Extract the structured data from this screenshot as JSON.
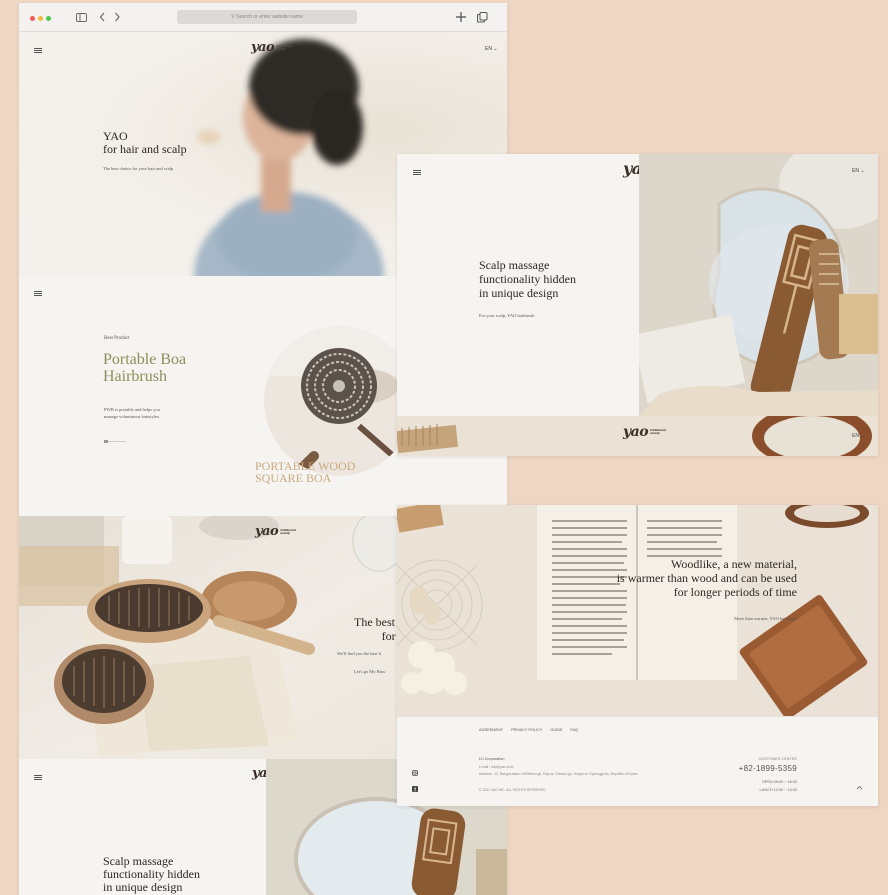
{
  "browser": {
    "address_placeholder": "Search or enter website name",
    "icons": [
      "sidebar-icon",
      "back-icon",
      "forward-icon",
      "new-tab-icon",
      "tabs-icon"
    ]
  },
  "brand": {
    "logo": "yao",
    "logo_sub": "for Wellness hair and scalp",
    "lang": "EN"
  },
  "hero": {
    "title_line1": "YAO",
    "title_line2": "for hair and scalp",
    "subtitle": "The best choice for your hair and scalp"
  },
  "product": {
    "eyebrow": "Best Product",
    "title_line1": "Portable Boa",
    "title_line2": "Hairbrush",
    "desc_line1": "PWB is portable and helps you",
    "desc_line2": "manage voluminous hairstyles.",
    "overlay_line1": "PORTABLE WOOD",
    "overlay_line2": "SQUARE BOA"
  },
  "choice": {
    "title_line1": "The best sc",
    "title_line2": "for m",
    "line1": "We'll find you the best h",
    "link": "Let's go My Brus"
  },
  "massage": {
    "title_line1": "Scalp massage",
    "title_line2": "functionality hidden",
    "title_line3": "in unique design",
    "subtitle": "For your scalp, YAO hairbrush"
  },
  "woodlike": {
    "line1": "Woodlike, a new material,",
    "line2": "is warmer than wood and can be used",
    "line3": "for longer periods of time",
    "subtitle": "More than warmer, YAO hairbrush"
  },
  "footer": {
    "nav": [
      "AGREEMENT",
      "PRIVACY POLICY",
      "GUIDE",
      "FAQ"
    ],
    "company": "DJ Corporation",
    "email": "e-mail : info@yao.co.kr",
    "address": "Address : 12, Baegot-daero 1905beon-gil, Paju-si, Chosun-gu, Yongin-si, Gyeonggi-do, Republic of Korea",
    "copyright": "© 2021 YAO INC. ALL RIGHTS RESERVED.",
    "cs_label": "CUSTOMER CENTER",
    "phone": "+82-1899-5359",
    "open": "OPEN 09:00 ~ 18:00",
    "lunch": "LUNCH 12:00 ~ 13:00"
  }
}
